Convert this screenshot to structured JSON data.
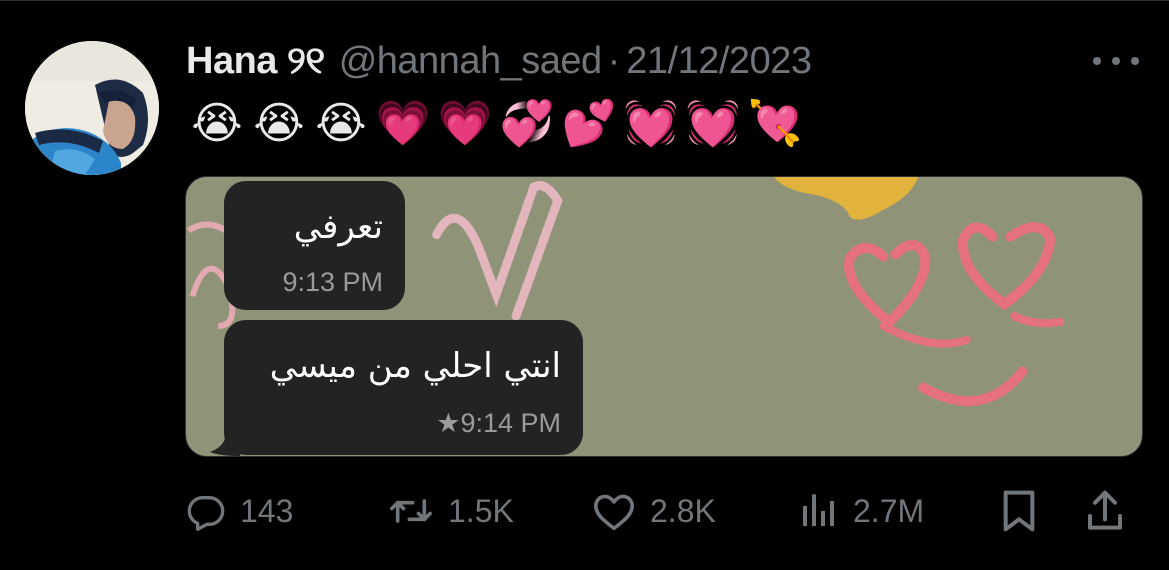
{
  "tweet": {
    "author_name": "Hana ୨୧",
    "handle": "@hannah_saed",
    "separator": "·",
    "date": "21/12/2023",
    "emojis": [
      "😭",
      "😭",
      "😭",
      "💗",
      "💗",
      "💞",
      "💕",
      "💓",
      "💓",
      "💘"
    ]
  },
  "media": {
    "messages": [
      {
        "text": "تعرفي",
        "time": "9:13 PM"
      },
      {
        "text": "انتي احلي من ميسي",
        "time": "★9:14 PM"
      }
    ]
  },
  "actions": {
    "replies": "143",
    "retweets": "1.5K",
    "likes": "2.8K",
    "views": "2.7M"
  },
  "colors": {
    "background": "#000000",
    "primary_text": "#e7e9ea",
    "secondary_text": "#71767b",
    "media_background": "#8f9479",
    "bubble": "#232323"
  },
  "icons": [
    "more-icon",
    "reply-icon",
    "retweet-icon",
    "like-icon",
    "views-icon",
    "bookmark-icon",
    "share-icon"
  ]
}
